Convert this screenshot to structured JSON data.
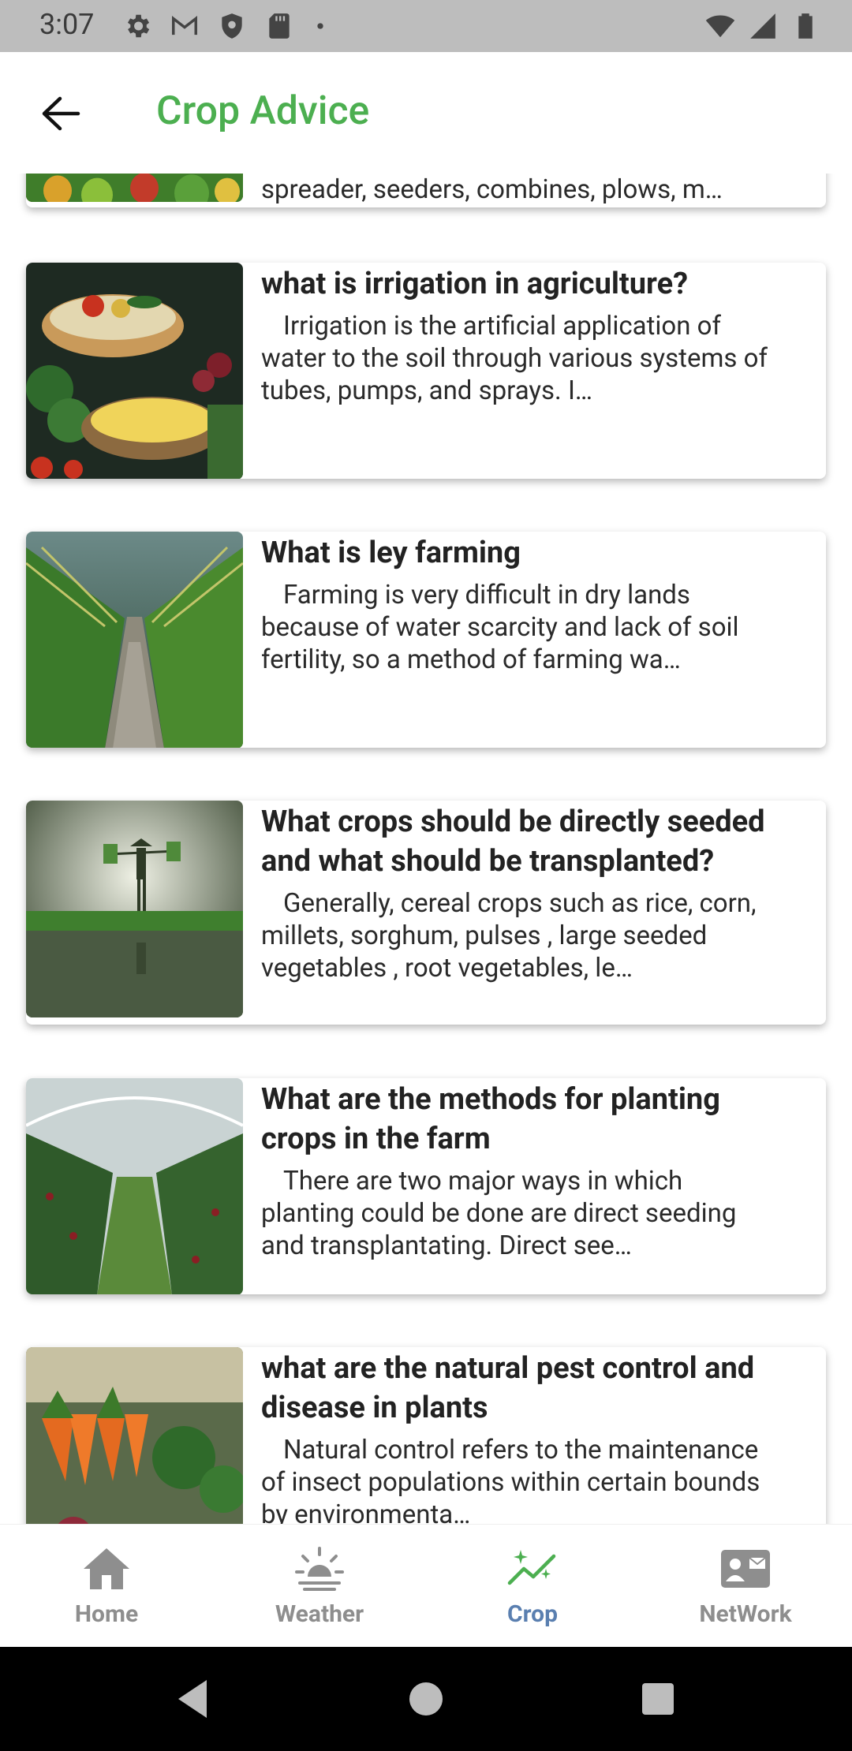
{
  "status_bar": {
    "time": "3:07",
    "left_icons": [
      "settings-icon",
      "gmail-icon",
      "shield-icon",
      "sd-card-icon",
      "dot-icon"
    ],
    "right_icons": [
      "wifi-icon",
      "signal-icon",
      "battery-icon"
    ]
  },
  "app_bar": {
    "title": "Crop Advice",
    "back_icon": "arrow-left-icon",
    "title_color": "#4caf50"
  },
  "articles": [
    {
      "title": "",
      "body": "spreader, seeders, combines, plows, m…",
      "image": "market-produce-thumbnail"
    },
    {
      "title": "what is irrigation in agriculture?",
      "body": "Irrigation is the artificial application of water to the soil through various systems of tubes, pumps, and sprays. I…",
      "image": "vegetable-baskets-thumbnail"
    },
    {
      "title": "What is ley farming",
      "body": "Farming is very difficult in dry lands because of water scarcity and lack of soil fertility, so a method of farming wa…",
      "image": "cornfield-path-thumbnail"
    },
    {
      "title": "What crops should be directly seeded and what should be transplanted?",
      "body": "Generally, cereal crops such as rice, corn, millets, sorghum, pulses , large seeded vegetables , root vegetables, le…",
      "image": "rice-paddy-farmer-thumbnail"
    },
    {
      "title": "What are the methods for planting crops in the farm",
      "body": "There are two major ways in which planting could be done are direct seeding and transplantating. Direct see…",
      "image": "greenhouse-rows-thumbnail"
    },
    {
      "title": "what are the natural pest control and disease in plants",
      "body": "Natural control refers to the maintenance of insect populations within certain bounds by environmenta…",
      "image": "carrots-market-thumbnail"
    }
  ],
  "bottom_nav": {
    "items": [
      {
        "label": "Home",
        "icon": "home-icon"
      },
      {
        "label": "Weather",
        "icon": "weather-sun-icon"
      },
      {
        "label": "Crop",
        "icon": "crop-trend-icon"
      },
      {
        "label": "NetWork",
        "icon": "contact-card-icon"
      }
    ],
    "active": "Crop",
    "active_color": "#5a7fb0"
  },
  "system_nav": {
    "buttons": [
      "back-triangle-icon",
      "home-circle-icon",
      "recents-square-icon"
    ]
  }
}
